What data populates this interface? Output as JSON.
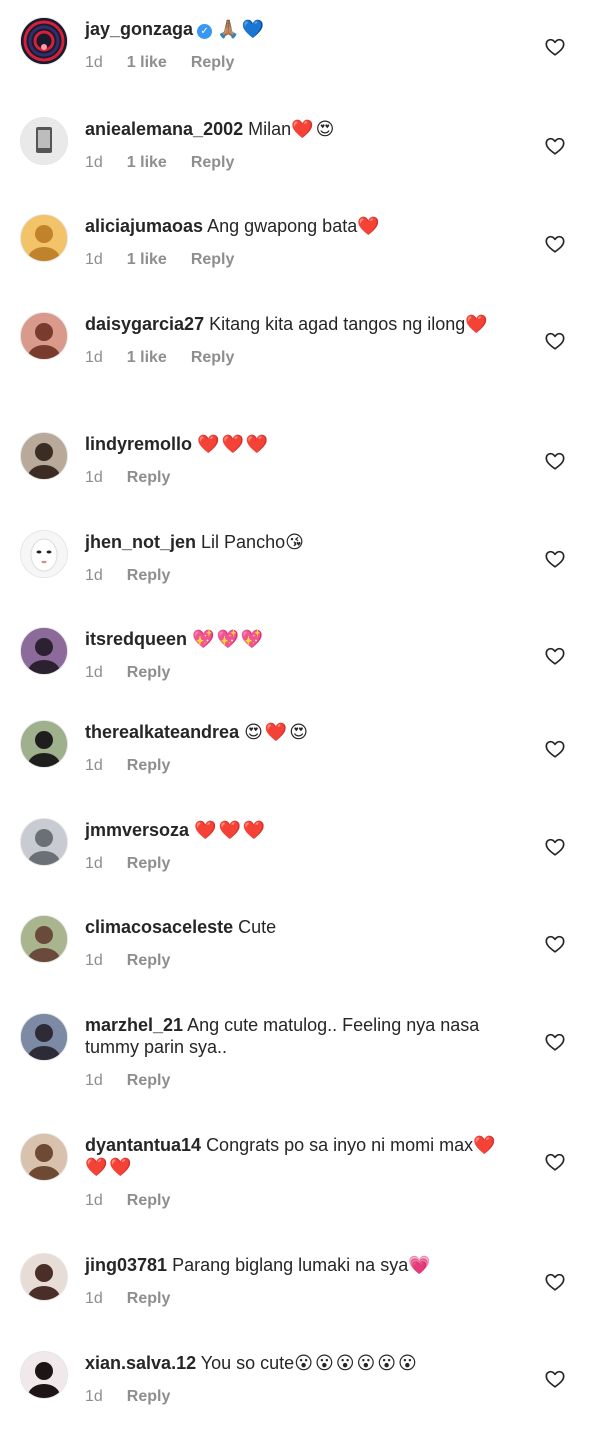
{
  "comments": [
    {
      "username": "jay_gonzaga",
      "verified": true,
      "text": "",
      "emoji": "🙏🏽💙",
      "time": "1d",
      "likes": "1 like",
      "reply": "Reply",
      "avatar": {
        "bg": "#1a1a2e",
        "fg": "#d6203a",
        "style": "rings"
      }
    },
    {
      "username": "aniealemana_2002",
      "verified": false,
      "text": "Milan",
      "emoji": "❤️😍",
      "time": "1d",
      "likes": "1 like",
      "reply": "Reply",
      "avatar": {
        "bg": "#e9e9e9",
        "fg": "#555555",
        "style": "phone"
      }
    },
    {
      "username": "aliciajumaoas",
      "verified": false,
      "text": "Ang gwapong bata",
      "emoji": "❤️",
      "time": "1d",
      "likes": "1 like",
      "reply": "Reply",
      "avatar": {
        "bg": "#f3c36a",
        "fg": "#c0832b",
        "style": "person"
      }
    },
    {
      "username": "daisygarcia27",
      "verified": false,
      "text": "Kitang kita agad tangos ng ilong",
      "emoji": "❤️",
      "time": "1d",
      "likes": "1 like",
      "reply": "Reply",
      "avatar": {
        "bg": "#d99a8c",
        "fg": "#7a3b2f",
        "style": "person"
      }
    },
    {
      "username": "lindyremollo",
      "verified": false,
      "text": "",
      "emoji": "❤️❤️❤️",
      "time": "1d",
      "likes": "",
      "reply": "Reply",
      "avatar": {
        "bg": "#b9a99a",
        "fg": "#3b2c24",
        "style": "person"
      }
    },
    {
      "username": "jhen_not_jen",
      "verified": false,
      "text": "Lil Pancho",
      "emoji": "😘",
      "time": "1d",
      "likes": "",
      "reply": "Reply",
      "avatar": {
        "bg": "#f6f6f6",
        "fg": "#222222",
        "style": "face"
      }
    },
    {
      "username": "itsredqueen",
      "verified": false,
      "text": "",
      "emoji": "💖💖💖",
      "time": "1d",
      "likes": "",
      "reply": "Reply",
      "avatar": {
        "bg": "#8c6a9a",
        "fg": "#2b2130",
        "style": "person"
      }
    },
    {
      "username": "therealkateandrea",
      "verified": false,
      "text": "",
      "emoji": "😍❤️😍",
      "time": "1d",
      "likes": "",
      "reply": "Reply",
      "avatar": {
        "bg": "#9fb08c",
        "fg": "#1e1e1e",
        "style": "person"
      }
    },
    {
      "username": "jmmversoza",
      "verified": false,
      "text": "",
      "emoji": "❤️❤️❤️",
      "time": "1d",
      "likes": "",
      "reply": "Reply",
      "avatar": {
        "bg": "#c8ccd2",
        "fg": "#6b6f76",
        "style": "person"
      }
    },
    {
      "username": "climacosaceleste",
      "verified": false,
      "text": "Cute",
      "emoji": "",
      "time": "1d",
      "likes": "",
      "reply": "Reply",
      "avatar": {
        "bg": "#a9b58f",
        "fg": "#6a4a3a",
        "style": "person"
      }
    },
    {
      "username": "marzhel_21",
      "verified": false,
      "text": "Ang cute matulog.. Feeling nya nasa tummy parin sya..",
      "emoji": "",
      "time": "1d",
      "likes": "",
      "reply": "Reply",
      "avatar": {
        "bg": "#7d8aa6",
        "fg": "#2d2b36",
        "style": "person"
      }
    },
    {
      "username": "dyantantua14",
      "verified": false,
      "text": "Congrats po sa inyo ni momi max",
      "emoji": "❤️❤️❤️",
      "time": "1d",
      "likes": "",
      "reply": "Reply",
      "avatar": {
        "bg": "#d8c2ae",
        "fg": "#6e4a35",
        "style": "person"
      }
    },
    {
      "username": "jing03781",
      "verified": false,
      "text": "Parang biglang lumaki na sya",
      "emoji": "💗",
      "time": "1d",
      "likes": "",
      "reply": "Reply",
      "avatar": {
        "bg": "#e8ddd6",
        "fg": "#4a2f28",
        "style": "person"
      }
    },
    {
      "username": "xian.salva.12",
      "verified": false,
      "text": "You so cute",
      "emoji": "😮😮😮😮😮😮",
      "time": "1d",
      "likes": "",
      "reply": "Reply",
      "avatar": {
        "bg": "#f0e8ea",
        "fg": "#1d1416",
        "style": "person"
      }
    }
  ],
  "icons": {
    "like": "heart-outline-icon",
    "verified": "verified-badge-icon"
  },
  "colors": {
    "text": "#262626",
    "muted": "#8e8e8e",
    "verified": "#3897f0"
  }
}
